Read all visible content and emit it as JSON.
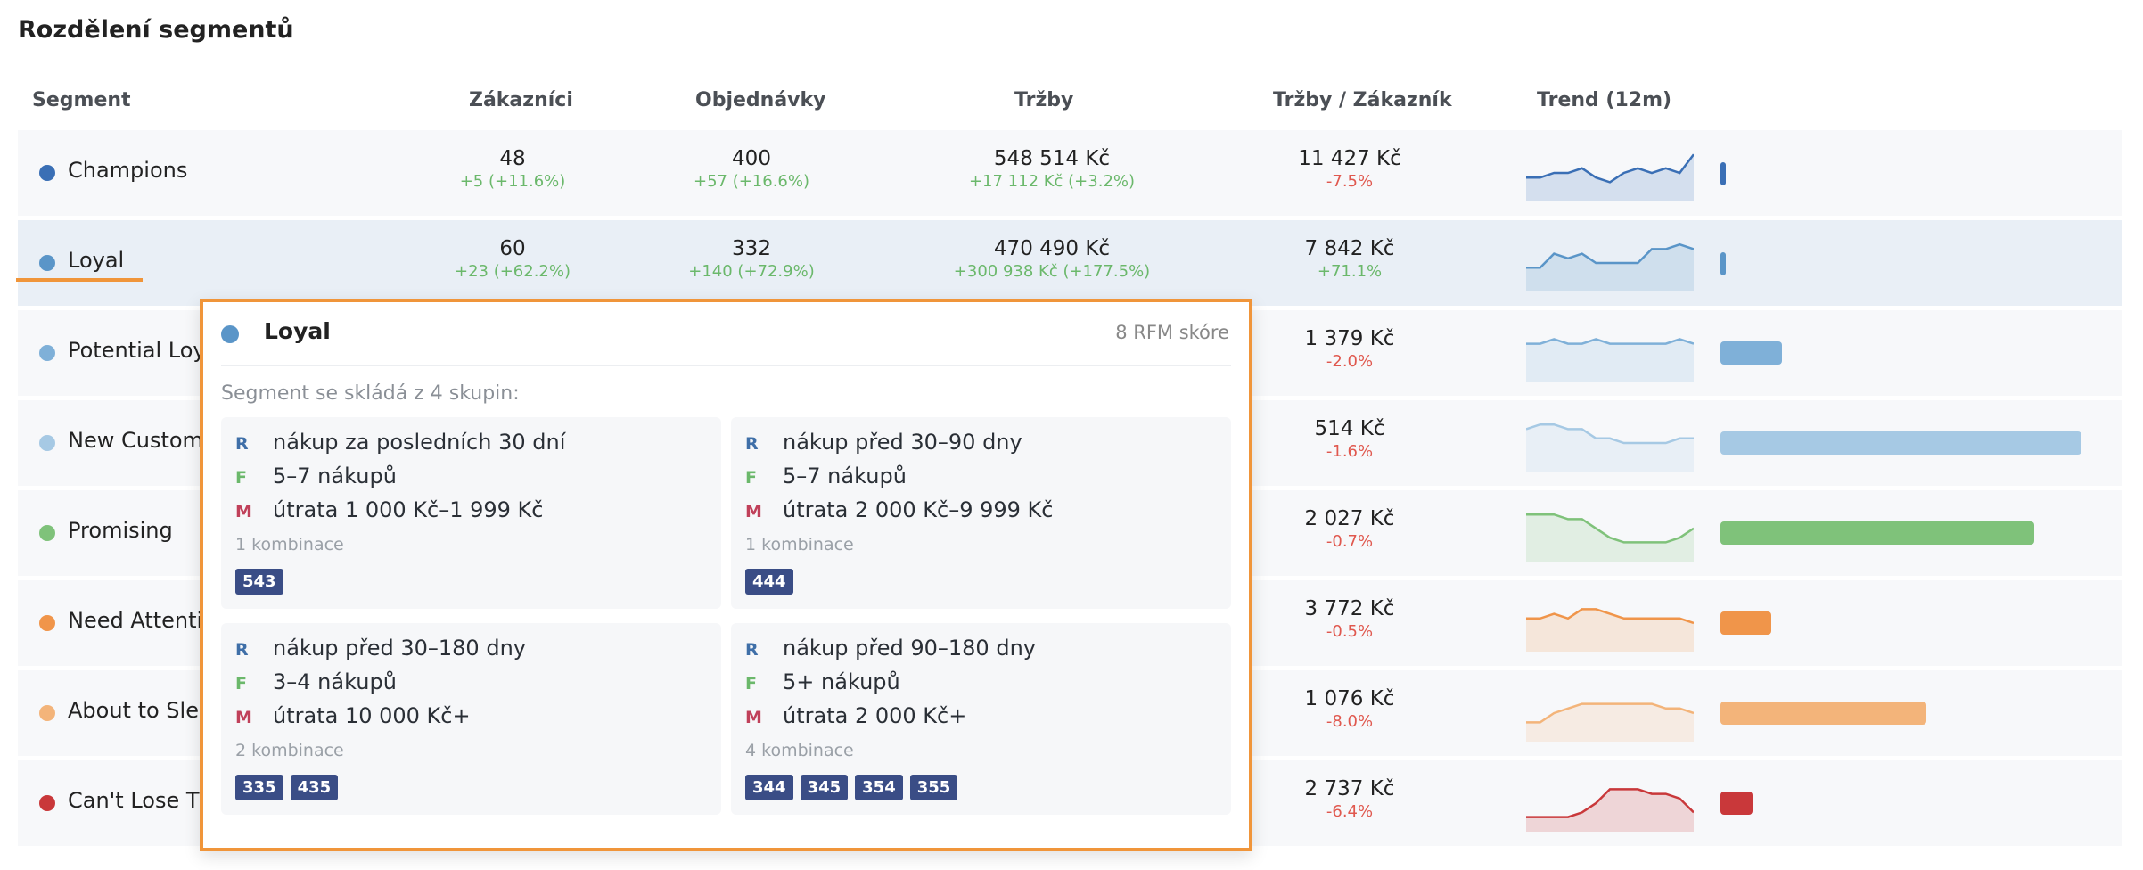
{
  "page_title": "Rozdělení segmentů",
  "headers": {
    "segment": "Segment",
    "customers": "Zákazníci",
    "orders": "Objednávky",
    "revenue": "Tržby",
    "rev_per_customer": "Tržby / Zákazník",
    "trend": "Trend (12m)"
  },
  "rows": [
    {
      "name": "Champions",
      "color": "#3a6fb5",
      "customers": "48",
      "customers_delta": "+5 (+11.6%)",
      "orders": "400",
      "orders_delta": "+57 (+16.6%)",
      "revenue": "548 514 Kč",
      "revenue_delta": "+17 112 Kč (+3.2%)",
      "rpc": "11 427 Kč",
      "rpc_delta": "-7.5%",
      "share": 0.01,
      "trend": [
        4,
        4,
        5,
        5,
        6,
        4,
        3,
        5,
        6,
        5,
        6,
        5,
        9
      ]
    },
    {
      "name": "Loyal",
      "color": "#5a95c8",
      "customers": "60",
      "customers_delta": "+23 (+62.2%)",
      "orders": "332",
      "orders_delta": "+140 (+72.9%)",
      "revenue": "470 490 Kč",
      "revenue_delta": "+300 938 Kč (+177.5%)",
      "rpc": "7 842 Kč",
      "rpc_delta": "+71.1%",
      "share": 0.01,
      "trend": [
        4,
        4,
        7,
        6,
        7,
        5,
        5,
        5,
        5,
        8,
        8,
        9,
        8
      ]
    },
    {
      "name": "Potential Loyalist",
      "color": "#7fb0d8",
      "customers": "",
      "customers_delta": "",
      "orders": "",
      "orders_delta": "",
      "revenue": "",
      "revenue_delta": "",
      "rpc": "1 379 Kč",
      "rpc_delta": "-2.0%",
      "share": 0.17,
      "trend": [
        7,
        7,
        8,
        7,
        7,
        8,
        7,
        7,
        7,
        7,
        7,
        8,
        7
      ]
    },
    {
      "name": "New Customers",
      "color": "#a6c9e4",
      "customers": "",
      "customers_delta": "",
      "orders": "",
      "orders_delta": "",
      "revenue": "",
      "revenue_delta": "",
      "rpc": "514 Kč",
      "rpc_delta": "-1.6%",
      "share": 1.0,
      "trend": [
        8,
        9,
        9,
        8,
        8,
        6,
        6,
        5,
        5,
        5,
        5,
        6,
        6
      ]
    },
    {
      "name": "Promising",
      "color": "#7fc27a",
      "customers": "",
      "customers_delta": "",
      "orders": "",
      "orders_delta": "",
      "revenue": "",
      "revenue_delta": "",
      "rpc": "2 027 Kč",
      "rpc_delta": "-0.7%",
      "share": 0.87,
      "trend": [
        9,
        9,
        9,
        8,
        8,
        6,
        4,
        3,
        3,
        3,
        3,
        4,
        6
      ]
    },
    {
      "name": "Need Attention",
      "color": "#f0954a",
      "customers": "",
      "customers_delta": "",
      "orders": "",
      "orders_delta": "",
      "revenue": "",
      "revenue_delta": "",
      "rpc": "3 772 Kč",
      "rpc_delta": "-0.5%",
      "share": 0.14,
      "trend": [
        6,
        6,
        7,
        6,
        8,
        8,
        7,
        6,
        6,
        6,
        6,
        6,
        5
      ]
    },
    {
      "name": "About to Sleep",
      "color": "#f3b47a",
      "customers": "",
      "customers_delta": "",
      "orders": "",
      "orders_delta": "",
      "revenue": "",
      "revenue_delta": "",
      "rpc": "1 076 Kč",
      "rpc_delta": "-8.0%",
      "share": 0.57,
      "trend": [
        3,
        3,
        5,
        6,
        7,
        7,
        7,
        7,
        7,
        7,
        6,
        6,
        5
      ]
    },
    {
      "name": "Can't Lose Them",
      "color": "#c9383a",
      "customers": "",
      "customers_delta": "",
      "orders": "",
      "orders_delta": "",
      "revenue": "",
      "revenue_delta": "",
      "rpc": "2 737 Kč",
      "rpc_delta": "-6.4%",
      "share": 0.09,
      "trend": [
        2,
        2,
        2,
        2,
        3,
        5,
        8,
        8,
        8,
        7,
        7,
        6,
        3
      ]
    }
  ],
  "popover": {
    "title": "Loyal",
    "score": "8 RFM skóre",
    "subtitle": "Segment se skládá z 4 skupin:",
    "groups": [
      {
        "r": "nákup za posledních 30 dní",
        "f": "5–7 nákupů",
        "m": "útrata 1 000 Kč–1 999 Kč",
        "combos": "1 kombinace",
        "codes": [
          "543"
        ]
      },
      {
        "r": "nákup před 30–90 dny",
        "f": "5–7 nákupů",
        "m": "útrata 2 000 Kč–9 999 Kč",
        "combos": "1 kombinace",
        "codes": [
          "444"
        ]
      },
      {
        "r": "nákup před 30–180 dny",
        "f": "3–4 nákupů",
        "m": "útrata 10 000 Kč+",
        "combos": "2 kombinace",
        "codes": [
          "335",
          "435"
        ]
      },
      {
        "r": "nákup před 90–180 dny",
        "f": "5+ nákupů",
        "m": "útrata 2 000 Kč+",
        "combos": "4 kombinace",
        "codes": [
          "344",
          "345",
          "354",
          "355"
        ]
      }
    ],
    "letters": {
      "r": "R",
      "f": "F",
      "m": "M"
    }
  }
}
